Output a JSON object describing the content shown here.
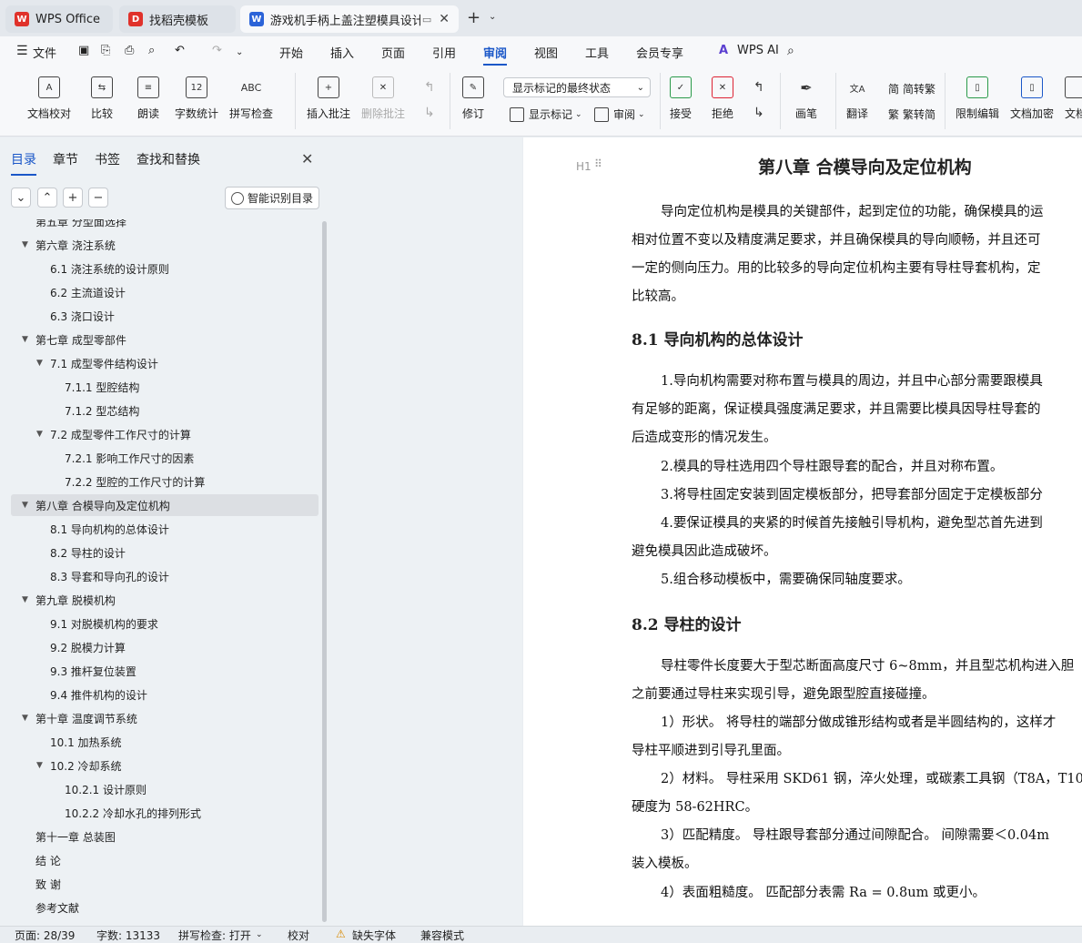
{
  "tabs": [
    {
      "label": "WPS Office",
      "icon": "wps-logo-icon",
      "color": "#e0322b"
    },
    {
      "label": "找稻壳模板",
      "icon": "docer-icon",
      "color": "#e0322b"
    },
    {
      "label": "游戏机手柄上盖注塑模具设计-",
      "icon": "word-doc-icon",
      "color": "#2b63d8"
    }
  ],
  "menu": {
    "file": "文件",
    "items": [
      "开始",
      "插入",
      "页面",
      "引用",
      "审阅",
      "视图",
      "工具",
      "会员专享"
    ],
    "active": "审阅",
    "ai": "WPS AI"
  },
  "ribbon": {
    "buttons": [
      "文档校对",
      "比较",
      "朗读",
      "字数统计",
      "拼写检查",
      "插入批注",
      "删除批注",
      "修订",
      "接受",
      "拒绝",
      "画笔",
      "翻译",
      "限制编辑",
      "文档加密",
      "文档"
    ],
    "show_markup_select": "显示标记的最终状态",
    "show_markup": "显示标记",
    "review": "审阅",
    "trad": "简转繁",
    "simp": "繁转简"
  },
  "sidebar": {
    "tabs": [
      "目录",
      "章节",
      "书签",
      "查找和替换"
    ],
    "ai_toc": "智能识别目录",
    "toc": [
      {
        "label": "第五章 分型面选择",
        "level": 1,
        "tri": ""
      },
      {
        "label": "第六章  浇注系统",
        "level": 1,
        "tri": "▼"
      },
      {
        "label": "6.1  浇注系统的设计原则",
        "level": 2,
        "tri": ""
      },
      {
        "label": "6.2  主流道设计",
        "level": 2,
        "tri": ""
      },
      {
        "label": "6.3  浇口设计",
        "level": 2,
        "tri": ""
      },
      {
        "label": "第七章  成型零部件",
        "level": 1,
        "tri": "▼"
      },
      {
        "label": "7.1  成型零件结构设计",
        "level": 2,
        "tri": "▼"
      },
      {
        "label": "7.1.1  型腔结构",
        "level": 3,
        "tri": ""
      },
      {
        "label": "7.1.2  型芯结构",
        "level": 3,
        "tri": ""
      },
      {
        "label": "7.2  成型零件工作尺寸的计算",
        "level": 2,
        "tri": "▼"
      },
      {
        "label": "7.2.1  影响工作尺寸的因素",
        "level": 3,
        "tri": ""
      },
      {
        "label": "7.2.2  型腔的工作尺寸的计算",
        "level": 3,
        "tri": ""
      },
      {
        "label": "第八章  合模导向及定位机构",
        "level": 1,
        "tri": "▼",
        "active": true
      },
      {
        "label": "8.1  导向机构的总体设计",
        "level": 2,
        "tri": ""
      },
      {
        "label": "8.2  导柱的设计",
        "level": 2,
        "tri": ""
      },
      {
        "label": "8.3  导套和导向孔的设计",
        "level": 2,
        "tri": ""
      },
      {
        "label": "第九章  脱模机构",
        "level": 1,
        "tri": "▼"
      },
      {
        "label": "9.1  对脱模机构的要求",
        "level": 2,
        "tri": ""
      },
      {
        "label": "9.2  脱模力计算",
        "level": 2,
        "tri": ""
      },
      {
        "label": "9.3  推杆复位装置",
        "level": 2,
        "tri": ""
      },
      {
        "label": "9.4  推件机构的设计",
        "level": 2,
        "tri": ""
      },
      {
        "label": "第十章  温度调节系统",
        "level": 1,
        "tri": "▼"
      },
      {
        "label": "10.1  加热系统",
        "level": 2,
        "tri": ""
      },
      {
        "label": "10.2  冷却系统",
        "level": 2,
        "tri": "▼"
      },
      {
        "label": "10.2.1  设计原则",
        "level": 3,
        "tri": ""
      },
      {
        "label": "10.2.2  冷却水孔的排列形式",
        "level": 3,
        "tri": ""
      },
      {
        "label": "第十一章  总装图",
        "level": 1,
        "tri": ""
      },
      {
        "label": "结  论",
        "level": 1,
        "tri": ""
      },
      {
        "label": "致  谢",
        "level": 1,
        "tri": ""
      },
      {
        "label": "参考文献",
        "level": 1,
        "tri": ""
      }
    ]
  },
  "document": {
    "h1": "第八章  合模导向及定位机构",
    "heading_marker": "H1",
    "p1": [
      "导向定位机构是模具的关键部件，起到定位的功能，确保模具的运",
      "相对位置不变以及精度满足要求，并且确保模具的导向顺畅，并且还可",
      "一定的侧向压力。用的比较多的导向定位机构主要有导柱导套机构，定",
      "比较高。"
    ],
    "h2a": "8.1  导向机构的总体设计",
    "p2": [
      "1.导向机构需要对称布置与模具的周边，并且中心部分需要跟模具",
      "有足够的距离，保证模具强度满足要求，并且需要比模具因导柱导套的",
      "后造成变形的情况发生。",
      "2.模具的导柱选用四个导柱跟导套的配合，并且对称布置。",
      "3.将导柱固定安装到固定模板部分，把导套部分固定于定模板部分",
      "4.要保证模具的夹紧的时候首先接触引导机构，避免型芯首先进到",
      "避免模具因此造成破坏。",
      "5.组合移动模板中，需要确保同轴度要求。"
    ],
    "h2b": "8.2  导柱的设计",
    "p3": [
      "导柱零件长度要大于型芯断面高度尺寸 6~8mm，并且型芯机构进入胆",
      "之前要通过导柱来实现引导，避免跟型腔直接碰撞。",
      "1）形状。 将导柱的端部分做成锥形结构或者是半圆结构的，这样才",
      "导柱平顺进到引导孔里面。",
      "2）材料。 导柱采用 SKD61 钢，淬火处理，或碳素工具钢（T8A，T10",
      "硬度为 58-62HRC。",
      "3）匹配精度。 导柱跟导套部分通过间隙配合。 间隙需要＜0.04m",
      "装入模板。",
      "4）表面粗糙度。 匹配部分表需 Ra = 0.8um 或更小。"
    ]
  },
  "status": {
    "page": "页面: 28/39",
    "words": "字数: 13133",
    "spell": "拼写检查: 打开",
    "proof": "校对",
    "font": "缺失字体",
    "compat": "兼容模式"
  }
}
